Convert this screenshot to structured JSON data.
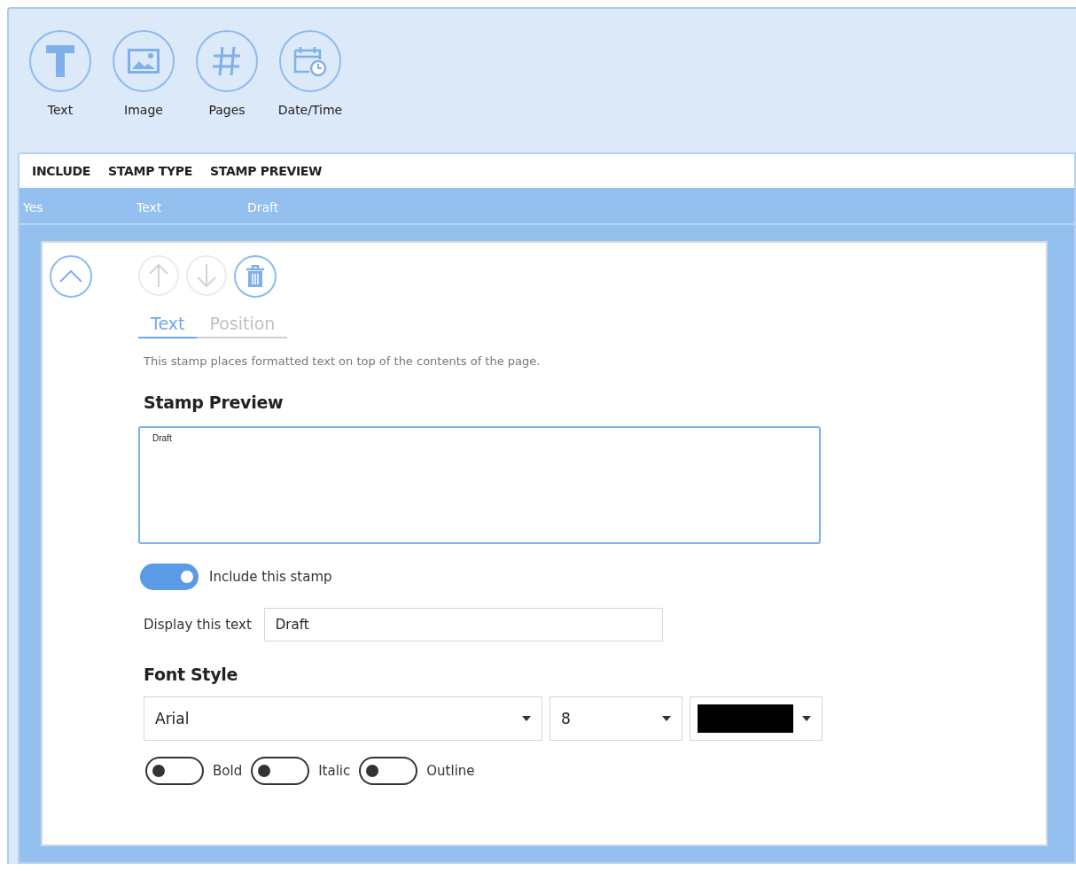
{
  "toolbar": [
    {
      "kind": "text",
      "label": "Text"
    },
    {
      "kind": "image",
      "label": "Image"
    },
    {
      "kind": "pages",
      "label": "Pages"
    },
    {
      "kind": "datetime",
      "label": "Date/Time"
    }
  ],
  "table": {
    "columns": [
      "INCLUDE",
      "STAMP TYPE",
      "STAMP PREVIEW"
    ],
    "rows": [
      {
        "include": "Yes",
        "stamp_type": "Text",
        "stamp_preview": "Draft",
        "selected": true
      }
    ]
  },
  "editor": {
    "expanded": true,
    "actions": [
      {
        "kind": "up",
        "disabled": true
      },
      {
        "kind": "down",
        "disabled": true
      },
      {
        "kind": "delete",
        "disabled": false
      }
    ],
    "tabs": [
      {
        "label": "Text",
        "selected": true
      },
      {
        "label": "Position",
        "selected": false
      }
    ],
    "description": "This stamp places formatted text on top of the contents of the page.",
    "preview_heading": "Stamp Preview",
    "preview_text": "Draft",
    "include_toggle": {
      "label": "Include this stamp",
      "on": true
    },
    "display": {
      "label": "Display this text",
      "value": "Draft"
    },
    "font_heading": "Font Style",
    "font": {
      "value": "Arial"
    },
    "size": {
      "value": "8"
    },
    "color_picker": {
      "color": "#000000"
    },
    "style_toggles": [
      {
        "label": "Bold",
        "on": false
      },
      {
        "label": "Italic",
        "on": false
      },
      {
        "label": "Outline",
        "on": false
      }
    ]
  }
}
